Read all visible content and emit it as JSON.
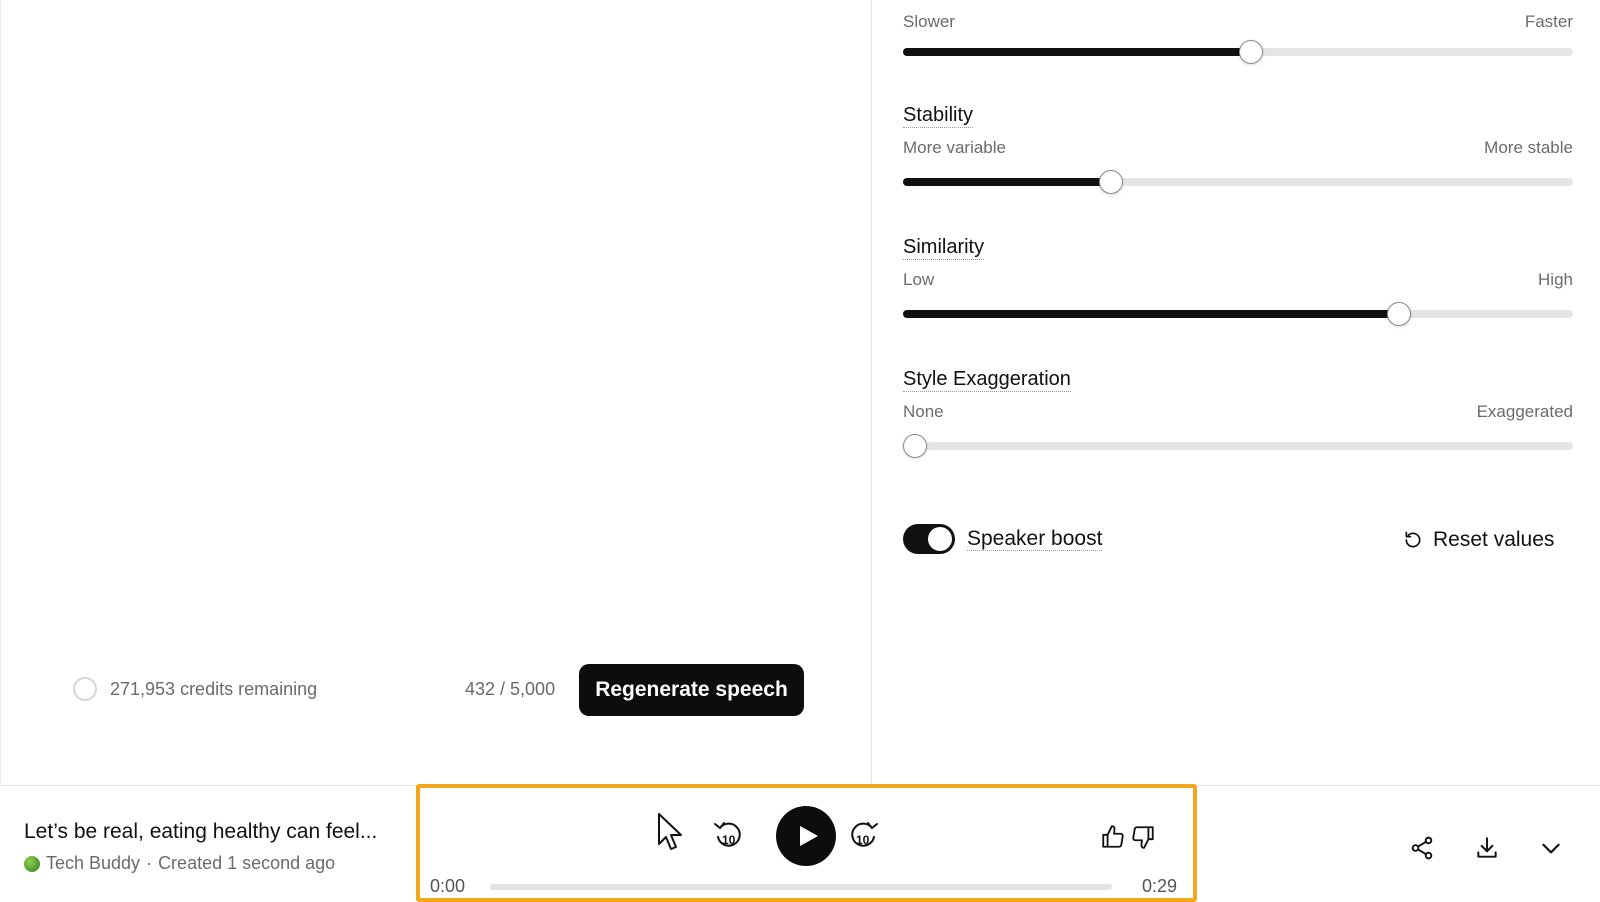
{
  "settings": {
    "speed": {
      "min_label": "Slower",
      "max_label": "Faster",
      "value": 0.52
    },
    "stability": {
      "title": "Stability",
      "min_label": "More variable",
      "max_label": "More stable",
      "value": 0.31
    },
    "similarity": {
      "title": "Similarity",
      "min_label": "Low",
      "max_label": "High",
      "value": 0.74
    },
    "style": {
      "title": "Style Exaggeration",
      "min_label": "None",
      "max_label": "Exaggerated",
      "value": 0.0
    },
    "speaker_boost": {
      "label": "Speaker boost",
      "enabled": true
    },
    "reset_label": "Reset values"
  },
  "editor_footer": {
    "credits": "271,953 credits remaining",
    "char_count": "432 / 5,000",
    "regenerate_label": "Regenerate speech"
  },
  "player": {
    "title": "Let’s be real, eating healthy can feel...",
    "voice": "Tech Buddy",
    "separator": "·",
    "created": "Created 1 second ago",
    "current_time": "0:00",
    "duration": "0:29",
    "progress": 0.0,
    "skip_seconds": "10"
  },
  "colors": {
    "accent_highlight": "#f2a81d",
    "primary": "#111111",
    "track": "#e5e5e5"
  }
}
